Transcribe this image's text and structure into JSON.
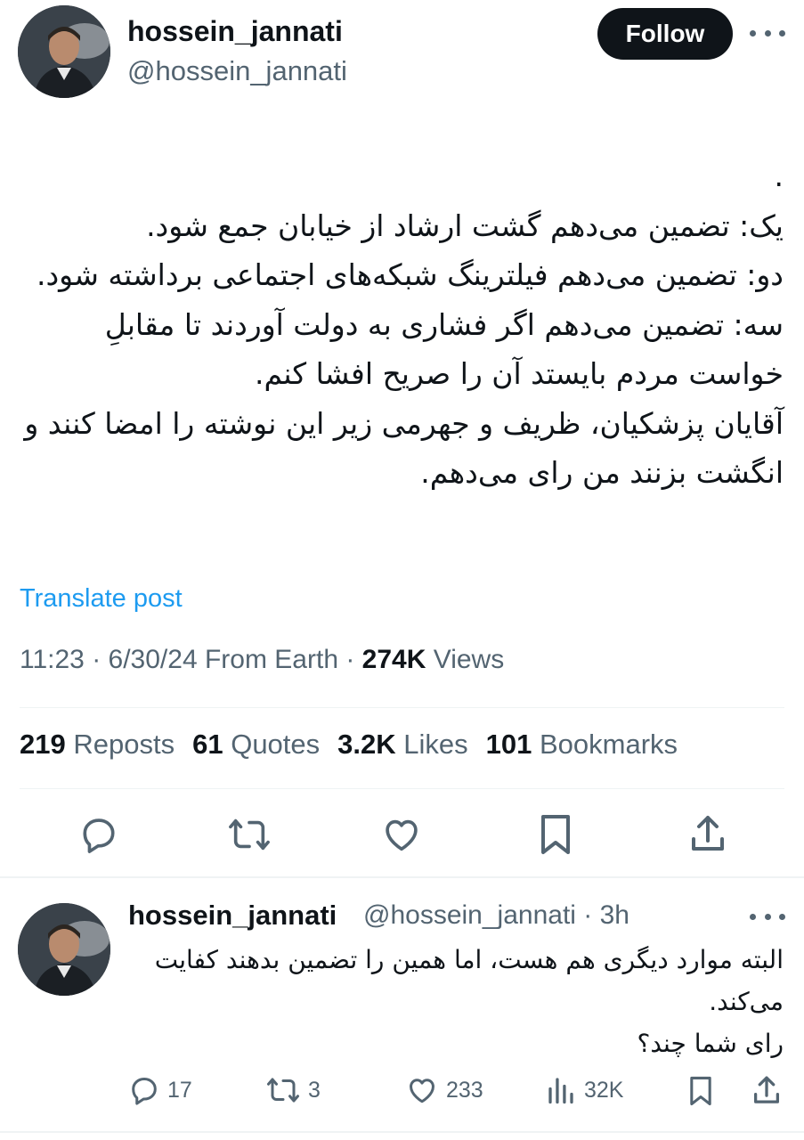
{
  "tweet": {
    "author_name": "hossein_jannati",
    "author_handle": "@hossein_jannati",
    "follow_label": "Follow",
    "text": ".\nیک: تضمین می‌دهم گشت ارشاد از خیابان جمع شود.\nدو: تضمین می‌دهم فیلترینگ شبکه‌های اجتماعی برداشته شود.\nسه: تضمین می‌دهم اگر فشاری به دولت آوردند تا مقابلِ خواست مردم بایستد آن را صریح افشا کنم.\nآقایان پزشکیان، ظریف و جهرمی زیر این نوشته را امضا کنند و انگشت بزنند من رای می‌دهم.",
    "translate_label": "Translate post",
    "time": "11:23",
    "date": "6/30/24",
    "source": "From Earth",
    "views_count": "274K",
    "views_label": "Views",
    "stats": {
      "reposts_count": "219",
      "reposts_label": "Reposts",
      "quotes_count": "61",
      "quotes_label": "Quotes",
      "likes_count": "3.2K",
      "likes_label": "Likes",
      "bookmarks_count": "101",
      "bookmarks_label": "Bookmarks"
    }
  },
  "reply": {
    "author_name": "hossein_jannati",
    "author_handle": "@hossein_jannati",
    "time_ago": "3h",
    "text": "البته موارد دیگری هم هست، اما همین را تضمین بدهند کفایت می‌کند.\nرای شما چند؟",
    "replies": "17",
    "reposts": "3",
    "likes": "233",
    "views": "32K"
  },
  "icons": {
    "reply": "reply-icon",
    "repost": "repost-icon",
    "like": "heart-icon",
    "bookmark": "bookmark-icon",
    "share": "share-icon",
    "views": "analytics-icon",
    "more": "more-dots-icon"
  },
  "colors": {
    "accent": "#1d9bf0",
    "text": "#0f1419",
    "secondary": "#536471",
    "divider": "#eff3f4"
  }
}
